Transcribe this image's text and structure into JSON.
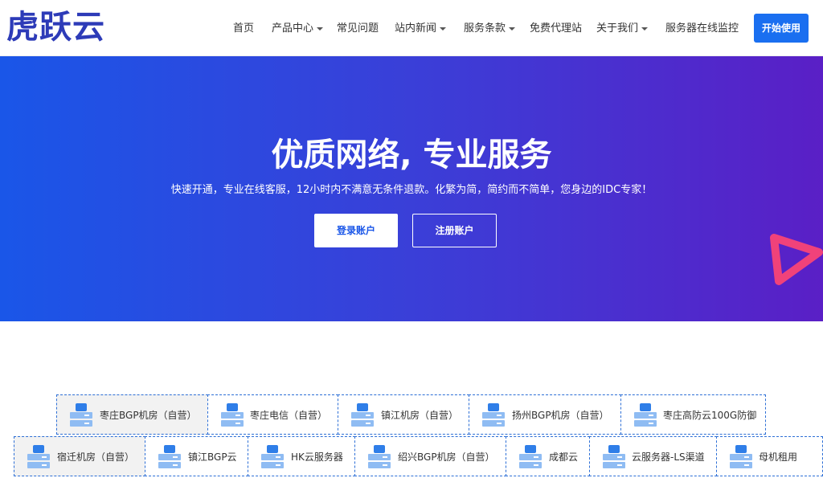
{
  "header": {
    "logo": "虎跃云",
    "nav": [
      {
        "label": "首页",
        "dropdown": false
      },
      {
        "label": "产品中心",
        "dropdown": true
      },
      {
        "label": "常见问题",
        "dropdown": false
      },
      {
        "label": "站内新闻",
        "dropdown": true
      },
      {
        "label": "服务条款",
        "dropdown": true
      },
      {
        "label": "免费代理站",
        "dropdown": false
      },
      {
        "label": "关于我们",
        "dropdown": true
      },
      {
        "label": "服务器在线监控",
        "dropdown": false
      }
    ],
    "start_label": "开始使用"
  },
  "hero": {
    "title": "优质网络, 专业服务",
    "subtitle": "快速开通，专业在线客服，12小时内不满意无条件退款。化繁为简，简约而不简单，您身边的IDC专家！",
    "login_label": "登录账户",
    "register_label": "注册账户"
  },
  "tabs_row1": [
    {
      "label": "枣庄BGP机房（自营）"
    },
    {
      "label": "枣庄电信（自营）"
    },
    {
      "label": "镇江机房（自营）"
    },
    {
      "label": "扬州BGP机房（自营）"
    },
    {
      "label": "枣庄高防云100G防御"
    }
  ],
  "tabs_row2": [
    {
      "label": "宿迁机房（自营）"
    },
    {
      "label": "镇江BGP云"
    },
    {
      "label": "HK云服务器"
    },
    {
      "label": "绍兴BGP机房（自营）"
    },
    {
      "label": "成都云"
    },
    {
      "label": "云服务器-LS渠道"
    },
    {
      "label": "母机租用"
    }
  ],
  "colors": {
    "brand": "#2d3bb8",
    "accent": "#1a6ff0",
    "hero_start": "#1a56e8",
    "hero_end": "#5a1fc6",
    "tab_border": "#2d6fd6"
  }
}
